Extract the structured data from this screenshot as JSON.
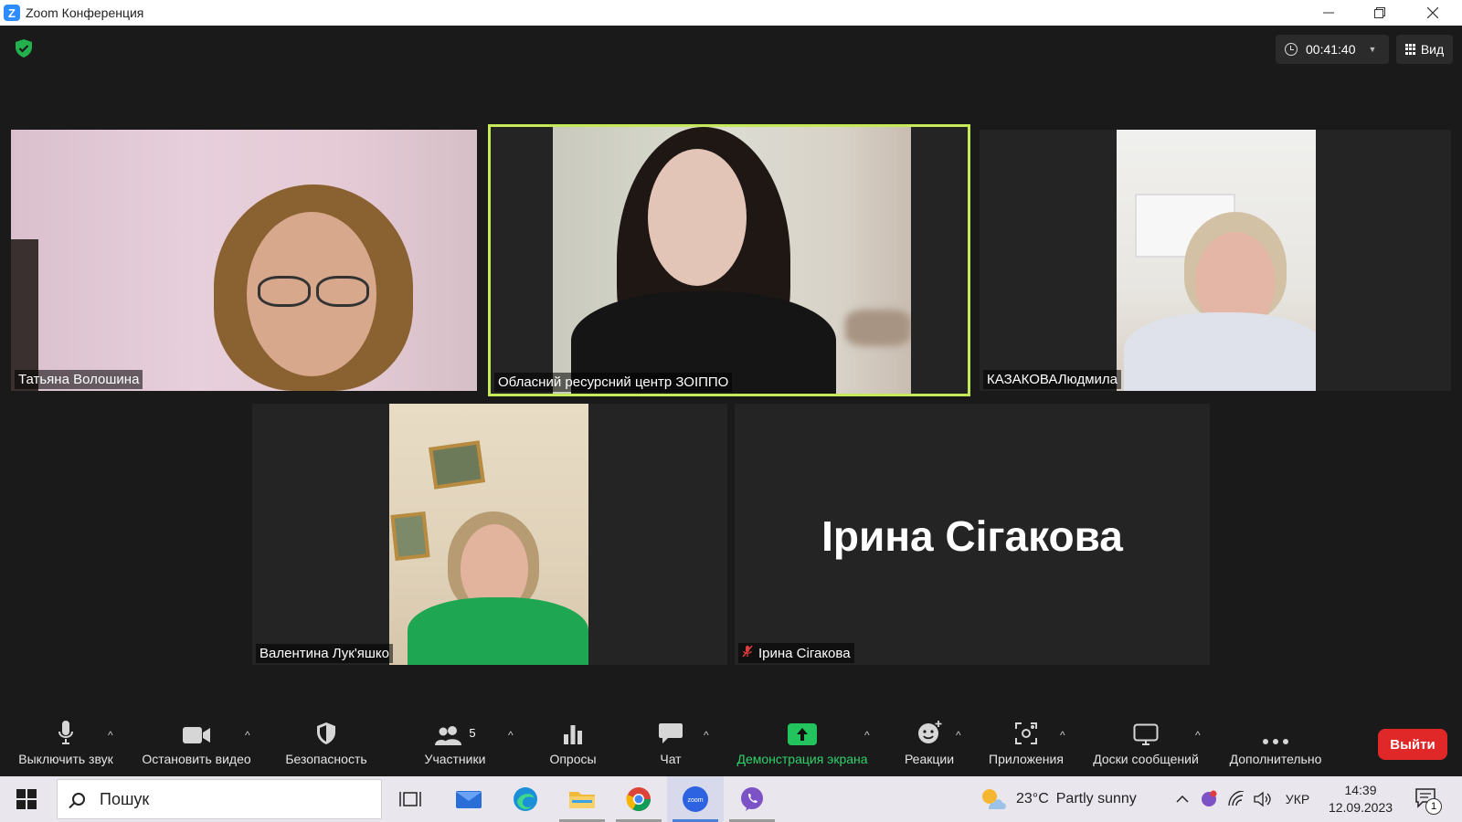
{
  "window": {
    "title": "Zoom Конференция",
    "logo": "Z"
  },
  "meeting": {
    "timer": "00:41:40",
    "view_label": "Вид",
    "accent_border": "#c6e95a",
    "participants": [
      {
        "name": "Татьяна Волошина"
      },
      {
        "name": "Обласний ресурсний центр ЗОІППО"
      },
      {
        "name": "КАЗАКОВАЛюдмила"
      },
      {
        "name": "Валентина Лук'яшко"
      },
      {
        "name": "Ірина Сігакова",
        "display_name": "Ірина Сігакова",
        "muted": true
      }
    ]
  },
  "toolbar": {
    "mute": "Выключить звук",
    "video": "Остановить видео",
    "security": "Безопасность",
    "participants": "Участники",
    "participants_count": "5",
    "polls": "Опросы",
    "chat": "Чат",
    "share": "Демонстрация экрана",
    "reactions": "Реакции",
    "apps": "Приложения",
    "whiteboards": "Доски сообщений",
    "more": "Дополнительно",
    "leave": "Выйти",
    "share_color": "#2fd16b",
    "leave_color": "#e02828"
  },
  "taskbar": {
    "search_placeholder": "Пошук",
    "weather_temp": "23°C",
    "weather_text": "Partly sunny",
    "language": "УКР",
    "time": "14:39",
    "date": "12.09.2023",
    "notifications": "1"
  }
}
